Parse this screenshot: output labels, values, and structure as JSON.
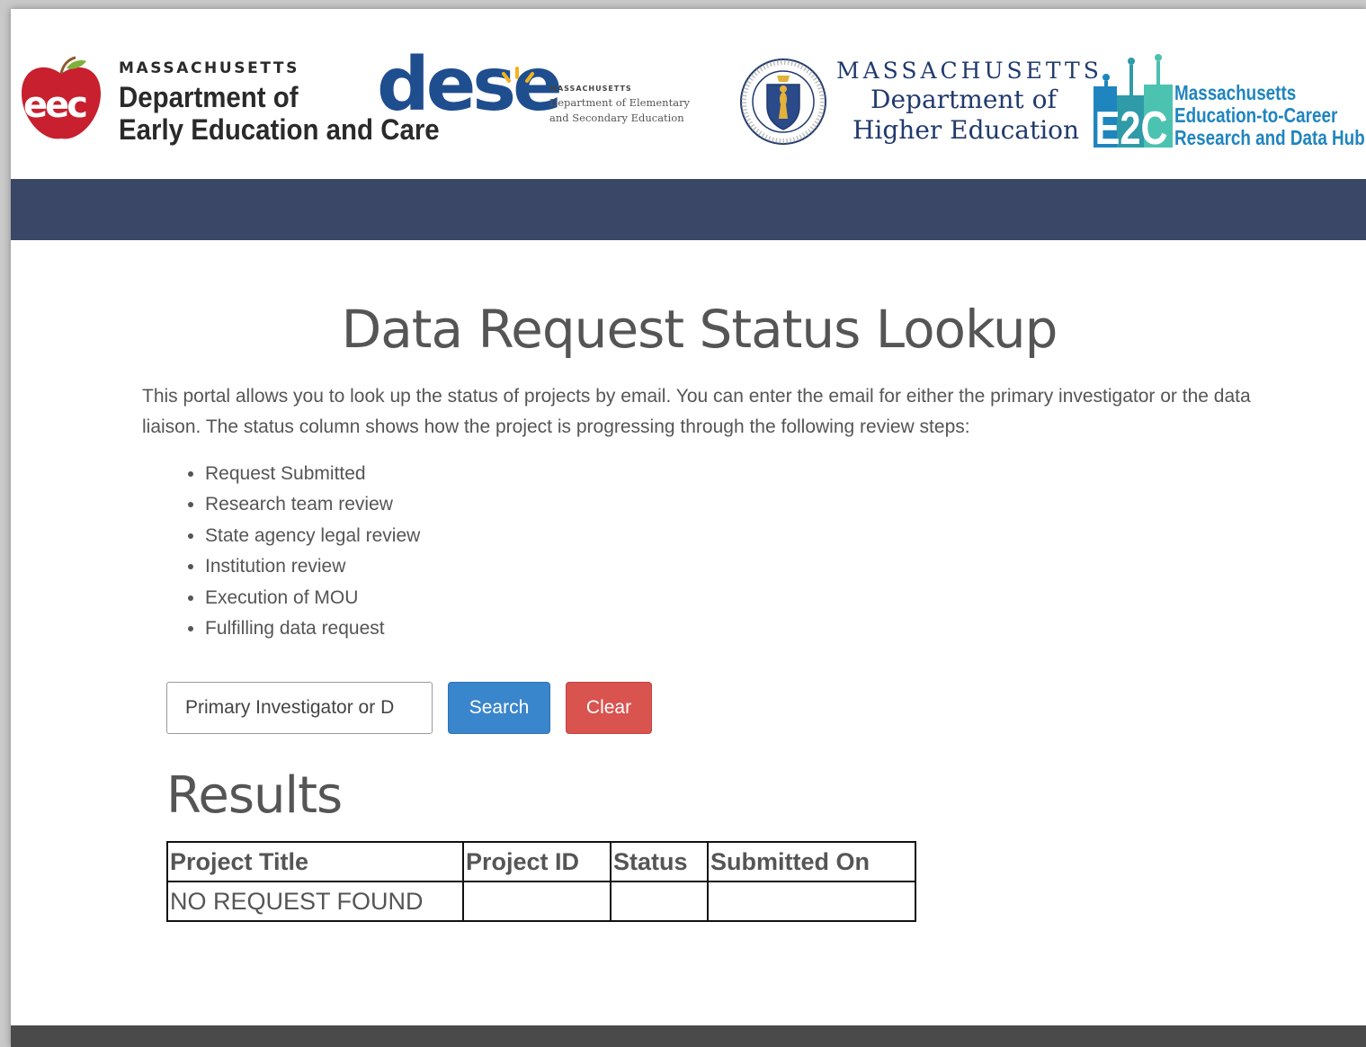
{
  "header": {
    "logos": {
      "eec": {
        "state": "MASSACHUSETTS",
        "line1": "Department of",
        "line2": "Early Education and Care",
        "mark": "eec"
      },
      "dese": {
        "mark": "dese",
        "state": "MASSACHUSETTS",
        "line1": "Department of Elementary",
        "line2": "and Secondary Education"
      },
      "dhe": {
        "state": "MASSACHUSETTS",
        "line1": "Department of",
        "line2": "Higher Education"
      },
      "e2c": {
        "mark": "E2C",
        "line1": "Massachusetts",
        "line2": "Education-to-Career",
        "line3": "Research and Data Hub"
      }
    },
    "colors": {
      "nav_band": "#3a4766",
      "footer_band": "#4a4a4a"
    }
  },
  "main": {
    "title": "Data Request Status Lookup",
    "intro": "This portal allows you to look up the status of projects by email. You can enter the email for either the primary investigator or the data liaison. The status column shows how the project is progressing through the following review steps:",
    "steps": [
      "Request Submitted",
      "Research team review",
      "State agency legal review",
      "Institution review",
      "Execution of MOU",
      "Fulfilling data request"
    ],
    "search": {
      "placeholder": "Primary Investigator or D",
      "value": "",
      "search_label": "Search",
      "clear_label": "Clear",
      "search_color": "#3a86cc",
      "clear_color": "#d9534f"
    },
    "results": {
      "heading": "Results",
      "columns": [
        "Project Title",
        "Project ID",
        "Status",
        "Submitted On"
      ],
      "rows": [
        [
          "NO REQUEST FOUND",
          "",
          "",
          ""
        ]
      ]
    }
  }
}
